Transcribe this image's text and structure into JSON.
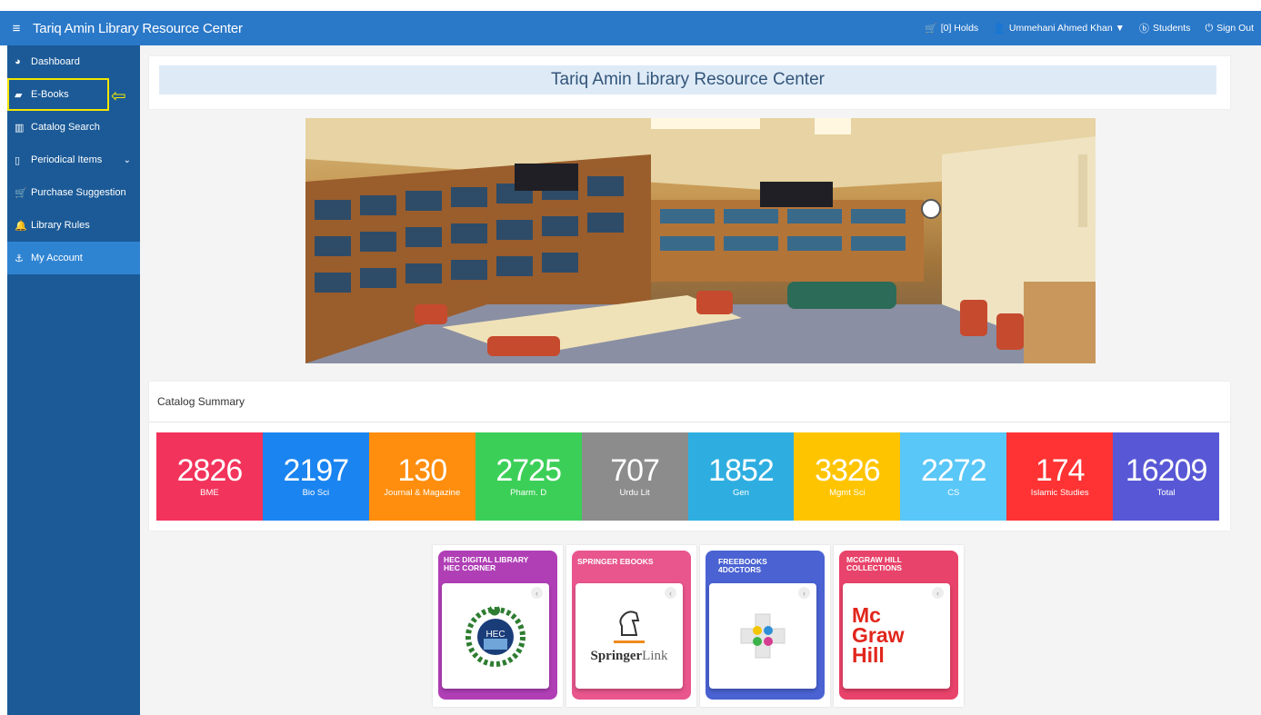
{
  "header": {
    "title": "Tariq Amin Library Resource Center",
    "holds": "[0] Holds",
    "user": "Ummehani Ahmed Khan ▼",
    "role": "Students",
    "sign_out": "Sign Out"
  },
  "sidebar": {
    "items": [
      {
        "label": "Dashboard",
        "icon": "pie-chart-icon"
      },
      {
        "label": "E-Books",
        "icon": "book-icon"
      },
      {
        "label": "Catalog Search",
        "icon": "open-book-icon"
      },
      {
        "label": "Periodical Items",
        "icon": "file-icon"
      },
      {
        "label": "Purchase Suggestion",
        "icon": "cart-icon"
      },
      {
        "label": "Library Rules",
        "icon": "bell-icon"
      },
      {
        "label": "My Account",
        "icon": "anchor-icon"
      }
    ]
  },
  "main": {
    "page_title": "Tariq Amin Library Resource Center",
    "summary_title": "Catalog Summary",
    "stats": [
      {
        "value": "2826",
        "label": "BME",
        "color": "#f2335b"
      },
      {
        "value": "2197",
        "label": "Bio Sci",
        "color": "#1a84f0"
      },
      {
        "value": "130",
        "label": "Journal & Magazine",
        "color": "#ff8e0e"
      },
      {
        "value": "2725",
        "label": "Pharm. D",
        "color": "#3ccf58"
      },
      {
        "value": "707",
        "label": "Urdu Lit",
        "color": "#8c8c8c"
      },
      {
        "value": "1852",
        "label": "Gen",
        "color": "#2eaee0"
      },
      {
        "value": "3326",
        "label": "Mgmt Sci",
        "color": "#ffc400"
      },
      {
        "value": "2272",
        "label": "CS",
        "color": "#59c7f7"
      },
      {
        "value": "174",
        "label": "Islamic Studies",
        "color": "#ff3333"
      },
      {
        "value": "16209",
        "label": "Total",
        "color": "#5858d6"
      }
    ],
    "ebooks": [
      {
        "title": "HEC DIGITAL LIBRARY\nHEC CORNER",
        "color": "#b03fb6"
      },
      {
        "title": "SPRINGER EBOOKS",
        "color": "#e8568d",
        "logo_text": "Springer",
        "logo_suffix": "Link"
      },
      {
        "title": "FREEBOOKS\n4DOCTORS",
        "color": "#4a62d2"
      },
      {
        "title": "MCGRAW HILL\nCOLLECTIONS",
        "color": "#e8436a",
        "logo_text": "Mc\nGraw\nHill"
      }
    ]
  }
}
